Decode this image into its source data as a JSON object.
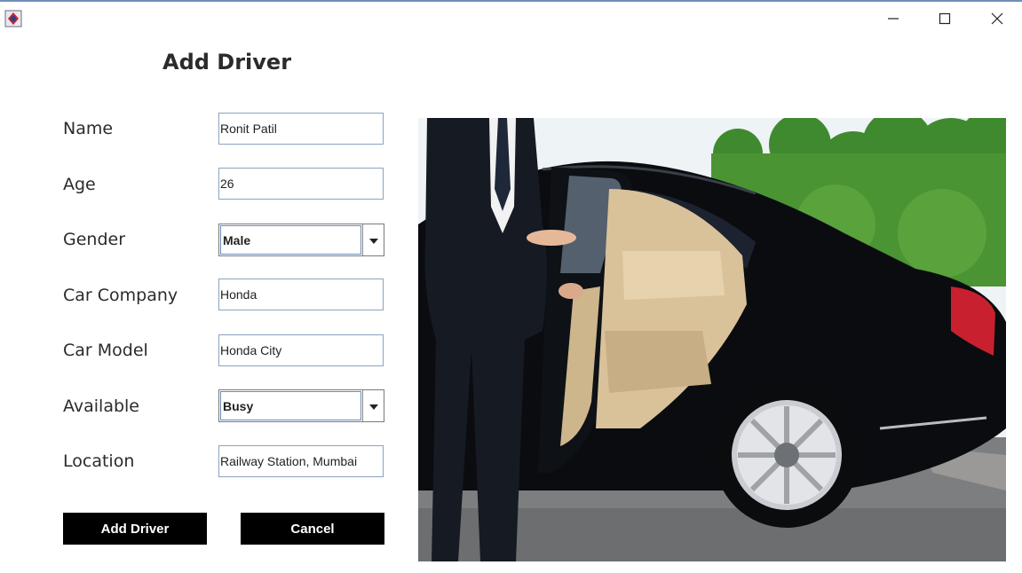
{
  "window": {
    "minimize_icon": "minimize-icon",
    "maximize_icon": "maximize-icon",
    "close_icon": "close-icon",
    "app_icon": "java-app-icon"
  },
  "form": {
    "title": "Add Driver",
    "fields": {
      "name": {
        "label": "Name",
        "value": "Ronit Patil"
      },
      "age": {
        "label": "Age",
        "value": "26"
      },
      "gender": {
        "label": "Gender",
        "value": "Male"
      },
      "car_company": {
        "label": "Car Company",
        "value": "Honda"
      },
      "car_model": {
        "label": "Car Model",
        "value": "Honda City"
      },
      "available": {
        "label": "Available",
        "value": "Busy"
      },
      "location": {
        "label": "Location",
        "value": "Railway Station, Mumbai"
      }
    },
    "buttons": {
      "add": "Add Driver",
      "cancel": "Cancel"
    }
  },
  "image": {
    "subject": "chauffeur-opening-black-sedan-door",
    "colors": {
      "car": "#0a0c10",
      "interior": "#d9c29a",
      "trees": "#3f8a2e",
      "sky": "#eef3f5",
      "suit": "#161a22"
    }
  }
}
